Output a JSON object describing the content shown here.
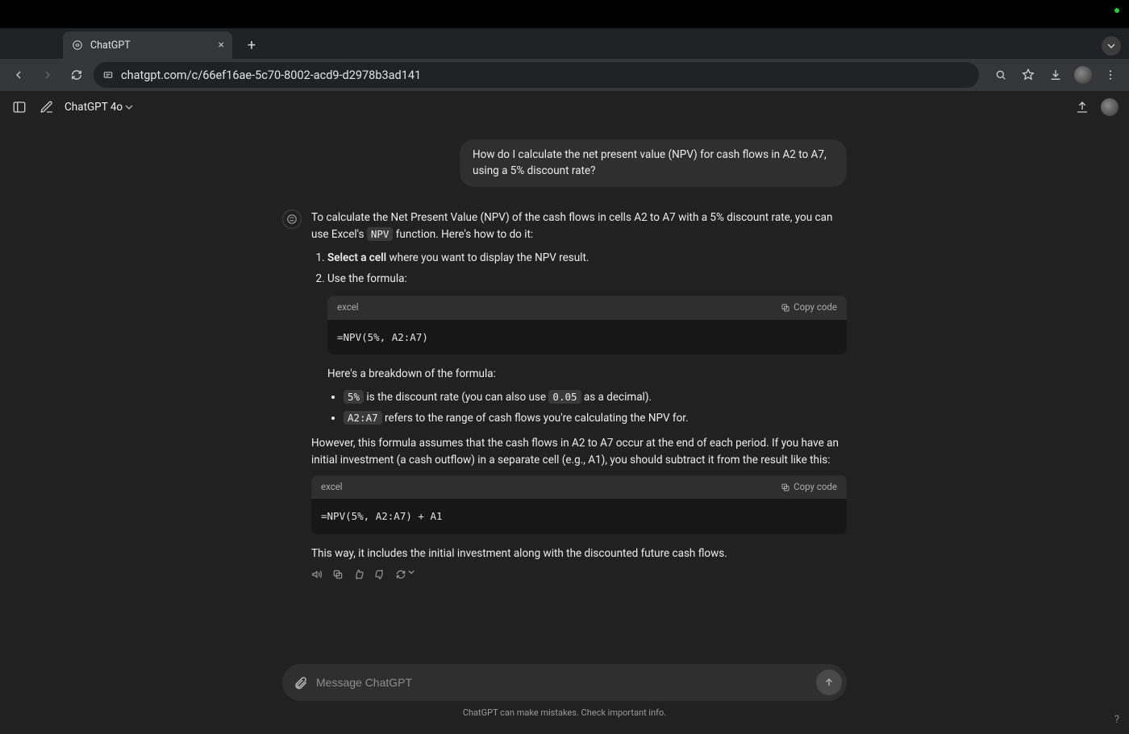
{
  "browser": {
    "tab_title": "ChatGPT",
    "url": "chatgpt.com/c/66ef16ae-5c70-8002-acd9-d2978b3ad141"
  },
  "app": {
    "model_label": "ChatGPT 4o"
  },
  "chat": {
    "user_message": "How do I calculate the net present value (NPV) for cash flows in A2 to A7, using a 5% discount rate?",
    "assistant": {
      "intro_part1": "To calculate the Net Present Value (NPV) of the cash flows in cells A2 to A7 with a 5% discount rate, you can use Excel's ",
      "intro_code": "NPV",
      "intro_part2": " function. Here's how to do it:",
      "step1_bold": "Select a cell",
      "step1_rest": " where you want to display the NPV result.",
      "step2": "Use the formula:",
      "code1_lang": "excel",
      "code1": "=NPV(5%, A2:A7)",
      "breakdown_intro": "Here's a breakdown of the formula:",
      "b1_code": "5%",
      "b1_mid": " is the discount rate (you can also use ",
      "b1_code2": "0.05",
      "b1_tail": " as a decimal).",
      "b2_code": "A2:A7",
      "b2_tail": " refers to the range of cash flows you're calculating the NPV for.",
      "however": "However, this formula assumes that the cash flows in A2 to A7 occur at the end of each period. If you have an initial investment (a cash outflow) in a separate cell (e.g., A1), you should subtract it from the result like this:",
      "code2_lang": "excel",
      "code2": "=NPV(5%, A2:A7) + A1",
      "closing": "This way, it includes the initial investment along with the discounted future cash flows.",
      "copy_label": "Copy code"
    }
  },
  "composer": {
    "placeholder": "Message ChatGPT"
  },
  "footer": {
    "disclaimer": "ChatGPT can make mistakes. Check important info."
  }
}
